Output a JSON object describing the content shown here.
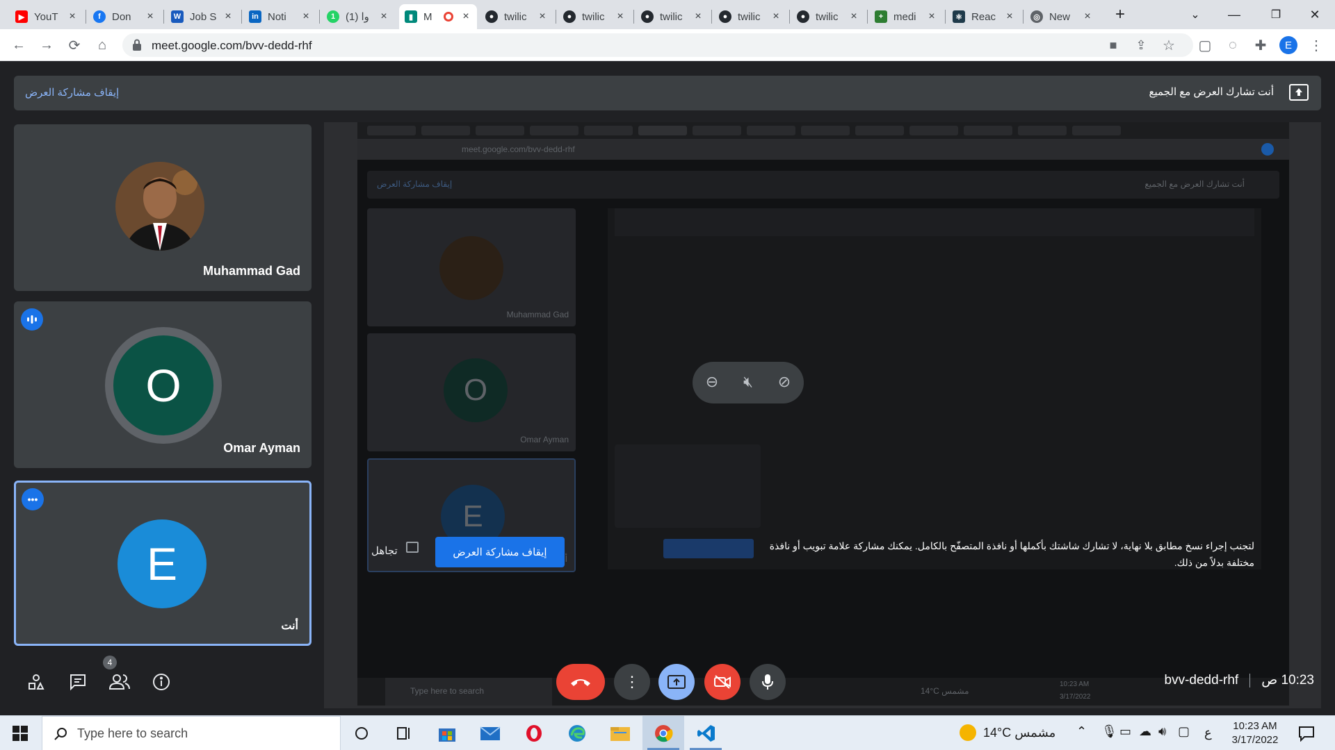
{
  "browser": {
    "tabs": [
      {
        "label": "YouT",
        "icon": "youtube-icon",
        "color": "#ff0000"
      },
      {
        "label": "Don",
        "icon": "facebook-icon",
        "color": "#1877f2"
      },
      {
        "label": "Job S",
        "icon": "word-icon",
        "color": "#185abd"
      },
      {
        "label": "Noti",
        "icon": "linkedin-icon",
        "color": "#0a66c2"
      },
      {
        "label": "(1) وا",
        "icon": "whatsapp-icon",
        "color": "#25d366"
      },
      {
        "label": "M",
        "icon": "meet-icon",
        "color": "#00897b"
      },
      {
        "label": "twilic",
        "icon": "github-icon",
        "color": "#24292f"
      },
      {
        "label": "twilic",
        "icon": "github-icon",
        "color": "#24292f"
      },
      {
        "label": "twilic",
        "icon": "github-icon",
        "color": "#24292f"
      },
      {
        "label": "twilic",
        "icon": "github-icon",
        "color": "#24292f"
      },
      {
        "label": "twilic",
        "icon": "github-icon",
        "color": "#24292f"
      },
      {
        "label": "medi",
        "icon": "medix-icon",
        "color": "#2e7d32"
      },
      {
        "label": "Reac",
        "icon": "react-icon",
        "color": "#1f3a4a"
      },
      {
        "label": "New",
        "icon": "chrome-icon",
        "color": "#5f6368"
      }
    ],
    "url": "meet.google.com/bvv-dedd-rhf",
    "profile_initial": "E"
  },
  "meet": {
    "banner": {
      "stop_link": "إيقاف مشاركة العرض",
      "share_text": "أنت تشارك العرض مع الجميع"
    },
    "participants": [
      {
        "name": "Muhammad Gad",
        "type": "photo"
      },
      {
        "name": "Omar Ayman",
        "initial": "O",
        "color": "#0b5345",
        "speaking": true
      },
      {
        "name": "أنت",
        "initial": "E",
        "color": "#1a8cd8",
        "self": true
      }
    ],
    "presentation": {
      "warning": "لتجنب إجراء نسخ مطابق بلا نهاية، لا تشارك شاشتك بأكملها أو نافذة المتصفّح بالكامل. يمكنك مشاركة علامة تبويب أو نافذة مختلفة بدلاً من ذلك.",
      "stop_button": "إيقاف مشاركة العرض",
      "ignore": "تجاهل",
      "mirror": {
        "url": "meet.google.com/bvv-dedd-rhf",
        "banner_left": "إيقاف مشاركة العرض",
        "banner_right": "أنت تشارك العرض مع الجميع",
        "names": [
          "Muhammad Gad",
          "Omar Ayman",
          "أنت"
        ],
        "initials": [
          "O",
          "E"
        ],
        "search": "Type here to search",
        "weather": "14°C مشمس",
        "time": "10:23 AM",
        "date": "3/17/2022"
      }
    },
    "bottom": {
      "people_count": "4",
      "meeting_code": "bvv-dedd-rhf",
      "time": "10:23 ص"
    }
  },
  "taskbar": {
    "search_placeholder": "Type here to search",
    "weather": "14°C مشمس",
    "lang": "ع",
    "time": "10:23 AM",
    "date": "3/17/2022"
  },
  "colors": {
    "accent": "#1a73e8",
    "end_call": "#ea4335",
    "present_active": "#8ab4f8"
  }
}
